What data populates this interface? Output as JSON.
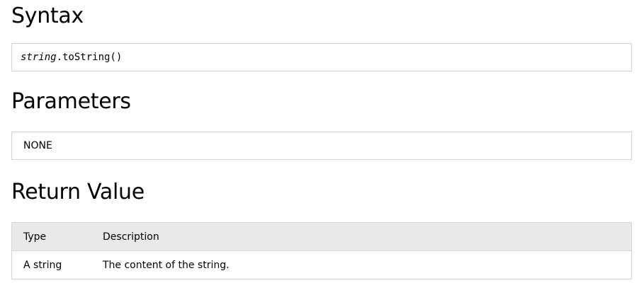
{
  "sections": {
    "syntax": {
      "heading": "Syntax",
      "code_object": "string",
      "code_method": ".toString()"
    },
    "parameters": {
      "heading": "Parameters",
      "value": "NONE"
    },
    "return_value": {
      "heading": "Return Value",
      "columns": [
        "Type",
        "Description"
      ],
      "rows": [
        [
          "A string",
          "The content of the string."
        ]
      ]
    }
  }
}
